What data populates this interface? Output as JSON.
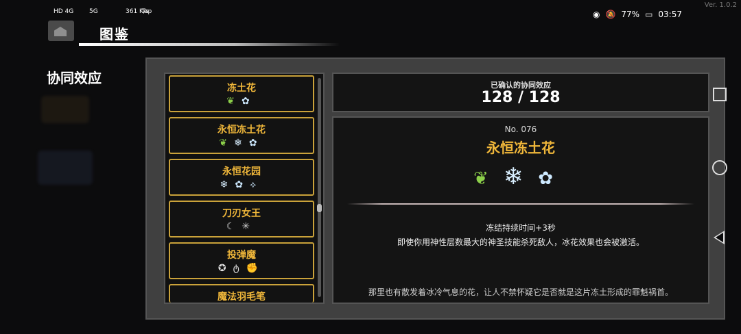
{
  "status_bar": {
    "signal_left": "HD 4G",
    "signal_right": "5G",
    "net_speed": "361 K/s",
    "tap": "Tap",
    "battery": "77%",
    "time": "03:57",
    "version": "Ver. 1.0.2"
  },
  "header": {
    "title": "图鉴"
  },
  "left_nav": {
    "heading": "协同效应"
  },
  "list": {
    "items": [
      {
        "name": "冻土花",
        "icons": [
          "leaf-icon",
          "ice-flower-icon"
        ]
      },
      {
        "name": "永恒冻土花",
        "icons": [
          "leaf-icon",
          "ice-orb-icon",
          "ice-flower-icon"
        ]
      },
      {
        "name": "永恒花园",
        "icons": [
          "ice-orb-icon",
          "ice-flower-icon",
          "branch-icon"
        ]
      },
      {
        "name": "刀刃女王",
        "icons": [
          "claw-icon",
          "spider-icon"
        ]
      },
      {
        "name": "投弹魔",
        "icons": [
          "bomb-icon",
          "flask-icon",
          "fist-icon"
        ]
      },
      {
        "name": "魔法羽毛笔",
        "icons": []
      }
    ]
  },
  "confirmed": {
    "label": "已确认的协同效应",
    "value": "128 / 128"
  },
  "detail": {
    "number": "No. 076",
    "name": "永恒冻土花",
    "effect_line1": "冻结持续时间+3秒",
    "effect_line2": "即使你用神性层数最大的神圣技能杀死敌人，冰花效果也会被激活。",
    "flavor": "那里也有散发着冰冷气息的花，让人不禁怀疑它是否就是这片冻土形成的罪魁祸首。"
  },
  "colors": {
    "accent": "#f0b73a",
    "panel": "#404040",
    "box": "#141414"
  }
}
